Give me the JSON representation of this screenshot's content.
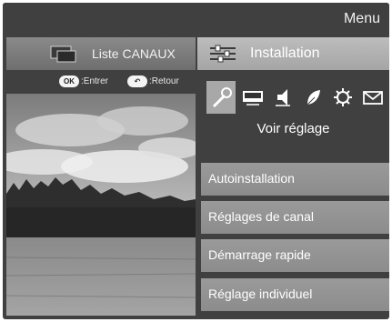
{
  "header": {
    "title": "Menu"
  },
  "left_panel": {
    "tab_label": "Liste CANAUX",
    "hints": [
      {
        "key": "OK",
        "action": ":Entrer"
      },
      {
        "key": "↶",
        "action": ":Retour"
      }
    ]
  },
  "right_panel": {
    "tab_label": "Installation",
    "category_icons": [
      "wrench-icon",
      "screen-icon",
      "speaker-icon",
      "leaf-icon",
      "gear-icon",
      "envelope-icon"
    ],
    "selected_category": "wrench-icon",
    "category_title": "Voir réglage",
    "items": [
      {
        "label": "Autoinstallation"
      },
      {
        "label": "Réglages de canal"
      },
      {
        "label": "Démarrage rapide"
      },
      {
        "label": "Réglage individuel"
      }
    ]
  },
  "colors": {
    "background": "#404040",
    "selected_tab": "#b3b3b3",
    "menu_item": "#929292"
  }
}
